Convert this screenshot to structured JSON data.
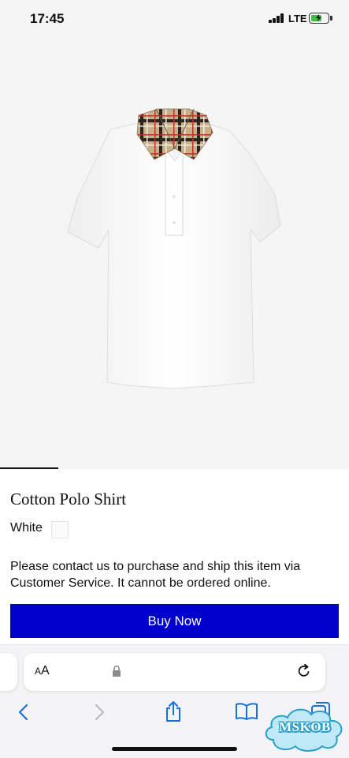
{
  "status_bar": {
    "time": "17:45",
    "network": "LTE"
  },
  "product": {
    "image_icon": "white-polo-shirt-with-check-collar",
    "title": "Cotton Polo Shirt",
    "color_label": "White",
    "notice": "Please contact us to purchase and ship this item via Customer Service. It cannot be ordered online.",
    "buy_label": "Buy Now",
    "buy_color": "#0000cc"
  },
  "browser": {
    "text_size_label": "AA",
    "icons": [
      "back-icon",
      "forward-icon",
      "share-icon",
      "bookmarks-icon",
      "tabs-icon",
      "lock-icon",
      "reload-icon"
    ]
  },
  "watermark": {
    "text": "MSKOB"
  }
}
